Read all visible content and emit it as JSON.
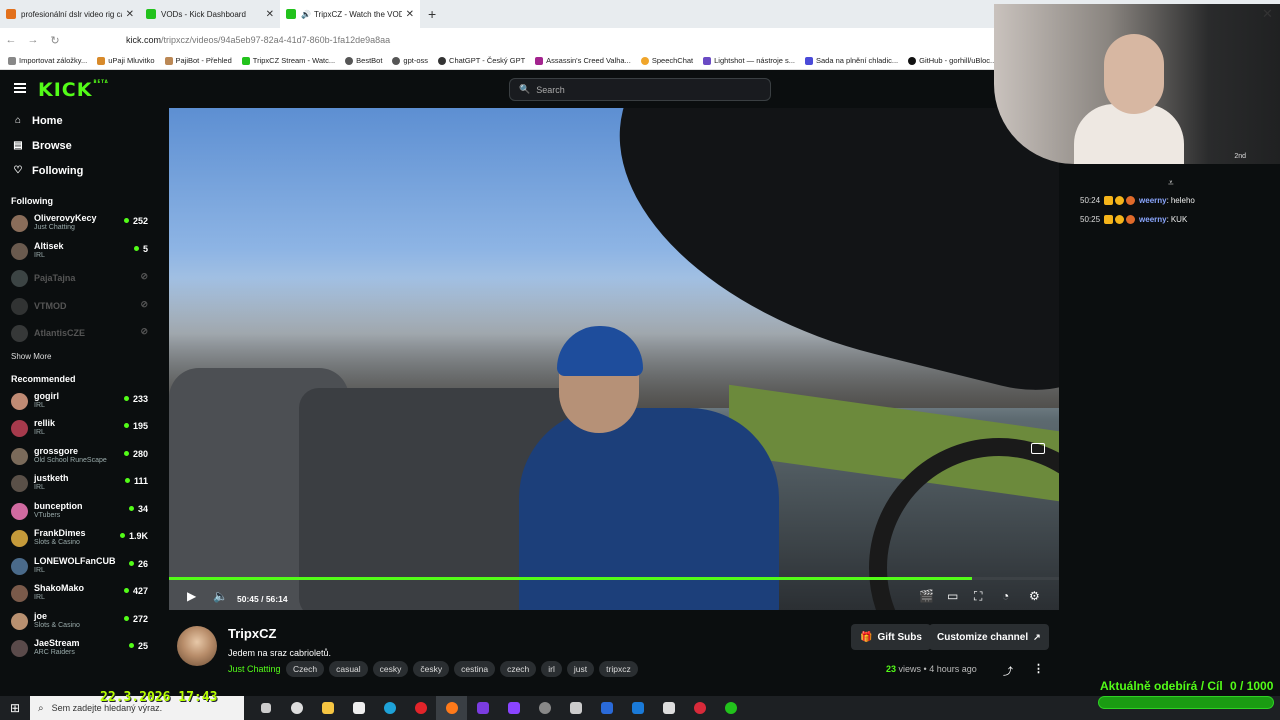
{
  "browser": {
    "tabs": [
      {
        "title": "profesionální dslr video rig cage",
        "color": "#e2701b"
      },
      {
        "title": "VODs - Kick Dashboard",
        "color": "#22c21c"
      },
      {
        "title": "TripxCZ - Watch the VOD o",
        "color": "#22c21c",
        "active": true
      }
    ],
    "url_host": "kick.com",
    "url_path": "/tripxcz/videos/94a5eb97-82a4-41d7-860b-1fa12de9a8aa",
    "bookmarks": [
      "Importovat záložky...",
      "uPaji Mluvitko",
      "PajiBot - Přehled",
      "TripxCZ Stream - Watc...",
      "BestBot",
      "gpt-oss",
      "ChatGPT - Český GPT",
      "Assassin's Creed Valha...",
      "SpeechChat",
      "Lightshot — nástroje s...",
      "Sada na plnění chladic...",
      "GitHub - gorhill/uBloc..."
    ]
  },
  "header": {
    "logo": "KICK",
    "logo_tag": "BETA",
    "search_placeholder": "Search"
  },
  "sidebar": {
    "nav": [
      {
        "label": "Home",
        "icon": "home-icon"
      },
      {
        "label": "Browse",
        "icon": "browse-icon"
      },
      {
        "label": "Following",
        "icon": "heart-icon"
      }
    ],
    "following_title": "Following",
    "following": [
      {
        "name": "OliverovyKecy",
        "category": "Just Chatting",
        "viewers": "252",
        "color": "#8a6d5a"
      },
      {
        "name": "Altisek",
        "category": "IRL",
        "viewers": "5",
        "color": "#6a5a4e"
      },
      {
        "name": "PajaTajna",
        "category": "",
        "viewers": "",
        "color": "#9aa",
        "offline": true
      },
      {
        "name": "VTMOD",
        "category": "",
        "viewers": "",
        "color": "#777",
        "offline": true
      },
      {
        "name": "AtlantisCZE",
        "category": "",
        "viewers": "",
        "color": "#888",
        "offline": true
      }
    ],
    "show_more": "Show More",
    "recommended_title": "Recommended",
    "recommended": [
      {
        "name": "gogirl",
        "category": "IRL",
        "viewers": "233",
        "color": "#c08b74"
      },
      {
        "name": "rellik",
        "category": "IRL",
        "viewers": "195",
        "color": "#a63a4c"
      },
      {
        "name": "grossgore",
        "category": "Old School RuneScape",
        "viewers": "280",
        "color": "#7a6a5a"
      },
      {
        "name": "justketh",
        "category": "IRL",
        "viewers": "111",
        "color": "#5a5048"
      },
      {
        "name": "bunception",
        "category": "VTubers",
        "viewers": "34",
        "color": "#d06aa0"
      },
      {
        "name": "FrankDimes",
        "category": "Slots & Casino",
        "viewers": "1.9K",
        "color": "#c59a3a"
      },
      {
        "name": "LONEWOLFanCUB",
        "category": "IRL",
        "viewers": "26",
        "color": "#4a6a8a"
      },
      {
        "name": "ShakoMako",
        "category": "IRL",
        "viewers": "427",
        "color": "#7a5a4a"
      },
      {
        "name": "joe",
        "category": "Slots & Casino",
        "viewers": "272",
        "color": "#b89070"
      },
      {
        "name": "JaeStream",
        "category": "ARC Raiders",
        "viewers": "25",
        "color": "#5a4a4a"
      }
    ]
  },
  "player": {
    "current_time": "50:45",
    "duration": "56:14",
    "time_display": "50:45 / 56:14",
    "progress_fraction": 0.9025
  },
  "chat": {
    "messages": [
      {
        "time": "50:24",
        "user": "weerny",
        "text": "heleho"
      },
      {
        "time": "50:25",
        "user": "weerny",
        "text": "KUK"
      }
    ]
  },
  "webcam": {
    "label": "2nd"
  },
  "info": {
    "channel": "TripxCZ",
    "title": "Jedem na sraz cabrioletů.",
    "category": "Just Chatting",
    "tags": [
      "Czech",
      "casual",
      "cesky",
      "česky",
      "cestina",
      "czech",
      "irl",
      "just",
      "tripxcz"
    ],
    "gift_label": "Gift Subs",
    "customize_label": "Customize channel",
    "views_count": "23",
    "views_label": "views",
    "age": "4 hours ago"
  },
  "overlay": {
    "goal_label": "Aktuálně odebírá / Cíl",
    "goal_value": "0 / 1000",
    "goal_current": 0,
    "goal_target": 1000,
    "timestamp": "22.3.2026 17:43"
  },
  "taskbar": {
    "search_placeholder": "Sem zadejte hledaný výraz."
  },
  "colors": {
    "accent": "#53fc18",
    "background": "#0b0e0f",
    "panel": "#2a2e31"
  }
}
